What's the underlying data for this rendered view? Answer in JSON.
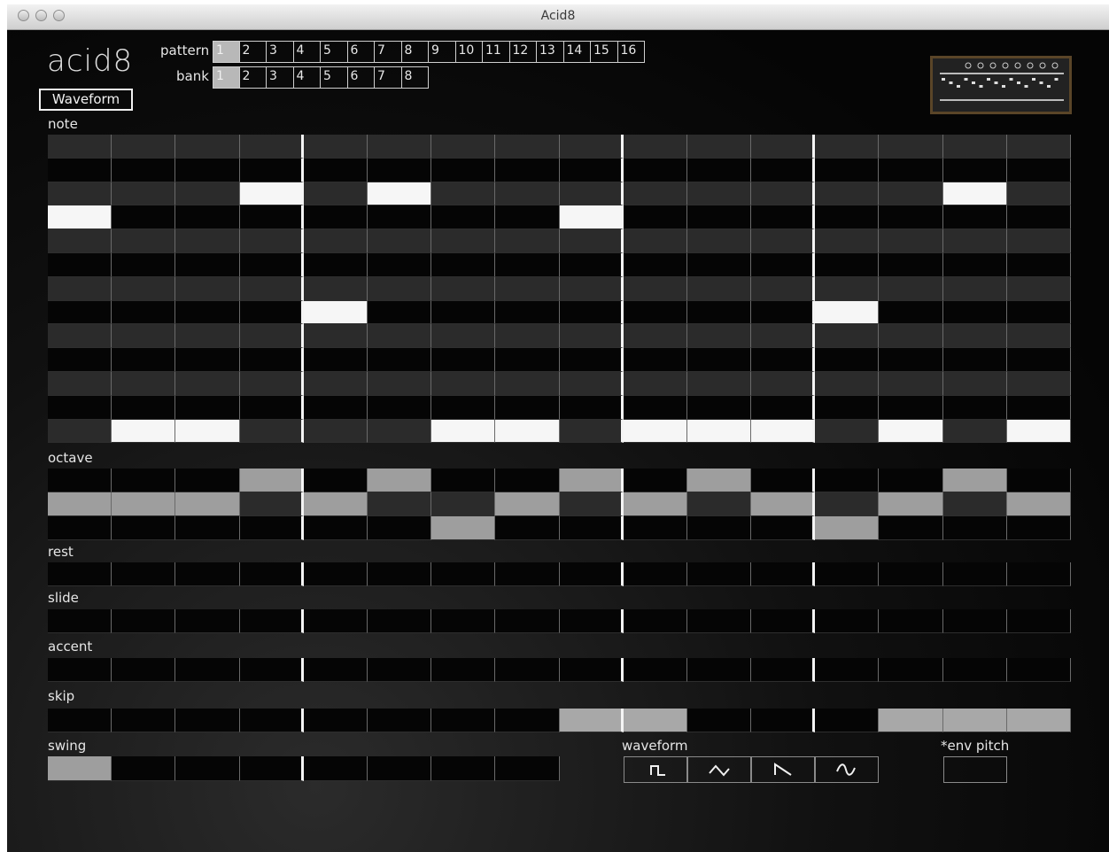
{
  "window": {
    "title": "Acid8"
  },
  "app": {
    "logo": "acid8",
    "waveform_button": "Waveform"
  },
  "pattern": {
    "label": "pattern",
    "items": [
      "1",
      "2",
      "3",
      "4",
      "5",
      "6",
      "7",
      "8",
      "9",
      "10",
      "11",
      "12",
      "13",
      "14",
      "15",
      "16"
    ],
    "selected": "1"
  },
  "bank": {
    "label": "bank",
    "items": [
      "1",
      "2",
      "3",
      "4",
      "5",
      "6",
      "7",
      "8"
    ],
    "selected": "1"
  },
  "rows": {
    "note": "note",
    "octave": "octave",
    "rest": "rest",
    "slide": "slide",
    "accent": "accent",
    "skip": "skip",
    "swing": "swing",
    "waveform": "waveform",
    "env_pitch": "*env pitch"
  },
  "sequence": {
    "steps": 16,
    "note_rows": 13,
    "note_active_row": [
      3,
      12,
      12,
      2,
      7,
      2,
      12,
      12,
      3,
      12,
      12,
      12,
      7,
      12,
      2,
      12
    ],
    "octave_value": [
      1,
      1,
      1,
      0,
      1,
      0,
      2,
      1,
      0,
      1,
      0,
      1,
      2,
      1,
      0,
      1
    ],
    "rest": [
      0,
      0,
      0,
      0,
      0,
      0,
      0,
      0,
      0,
      0,
      0,
      0,
      0,
      0,
      0,
      0
    ],
    "slide": [
      0,
      0,
      0,
      0,
      0,
      0,
      0,
      0,
      0,
      0,
      0,
      0,
      0,
      0,
      0,
      0
    ],
    "accent": [
      0,
      0,
      0,
      0,
      0,
      0,
      0,
      0,
      0,
      0,
      0,
      0,
      0,
      0,
      0,
      0
    ],
    "skip": [
      0,
      0,
      0,
      0,
      0,
      0,
      0,
      0,
      1,
      1,
      0,
      0,
      0,
      1,
      1,
      1
    ],
    "swing_selected": 0,
    "swing_steps": 8
  },
  "waveforms": [
    "square-wave-icon",
    "triangle-wave-icon",
    "saw-wave-icon",
    "sine-wave-icon"
  ],
  "colors": {
    "active": "#f6f6f6",
    "set": "#9e9e9e",
    "dark": "#050505",
    "mid": "#2b2b2b"
  }
}
